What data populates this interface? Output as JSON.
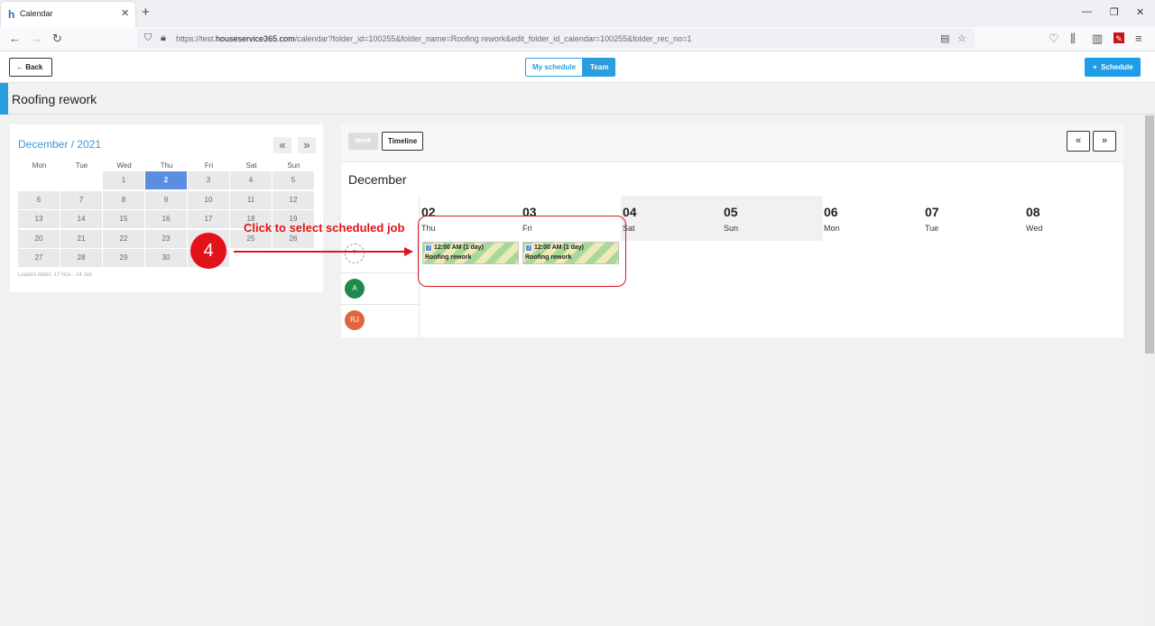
{
  "browser": {
    "tab_title": "Calendar",
    "url_prefix": "https://test.",
    "url_host": "houseservice365.com",
    "url_rest": "/calendar?folder_id=100255&folder_name=Roofing rework&edit_folder_id_calendar=100255&folder_rec_no=1"
  },
  "header": {
    "back_label": "Back",
    "my_schedule_label": "My schedule",
    "team_label": "Team",
    "schedule_label": "Schedule"
  },
  "page": {
    "title": "Roofing rework"
  },
  "mini_calendar": {
    "title": "December / 2021",
    "prev_label": "«",
    "next_label": "»",
    "weekdays": [
      "Mon",
      "Tue",
      "Wed",
      "Thu",
      "Fri",
      "Sat",
      "Sun"
    ],
    "weeks": [
      [
        "",
        "",
        "1",
        "2",
        "3",
        "4",
        "5"
      ],
      [
        "6",
        "7",
        "8",
        "9",
        "10",
        "11",
        "12"
      ],
      [
        "13",
        "14",
        "15",
        "16",
        "17",
        "18",
        "19"
      ],
      [
        "20",
        "21",
        "22",
        "23",
        "24",
        "25",
        "26"
      ],
      [
        "27",
        "28",
        "29",
        "30",
        "31",
        "",
        ""
      ]
    ],
    "selected_day": "2",
    "loaded_dates": "Loaded dates: 17 Nov - 14 Jan"
  },
  "scheduler": {
    "view_week": "Week",
    "view_timeline": "Timeline",
    "prev_label": "«",
    "next_label": "»",
    "month": "December",
    "days": [
      {
        "num": "02",
        "name": "Thu"
      },
      {
        "num": "03",
        "name": "Fri"
      },
      {
        "num": "04",
        "name": "Sat"
      },
      {
        "num": "05",
        "name": "Sun"
      },
      {
        "num": "06",
        "name": "Mon"
      },
      {
        "num": "07",
        "name": "Tue"
      },
      {
        "num": "08",
        "name": "Wed"
      }
    ],
    "resources": [
      {
        "initials": "A",
        "color": "#1e8a4c"
      },
      {
        "initials": "RJ",
        "color": "#e0643c"
      }
    ],
    "events": [
      {
        "time": "12:00 AM (1 day)",
        "name": "Roofing rework"
      },
      {
        "time": "12:00 AM (1 day)",
        "name": "Roofing rework"
      }
    ]
  },
  "annotation": {
    "step": "4",
    "text": "Click to select scheduled job",
    "color": "#e3111a"
  },
  "colors": {
    "accent": "#2b9ee0",
    "selected_day": "#5b8ee0"
  }
}
